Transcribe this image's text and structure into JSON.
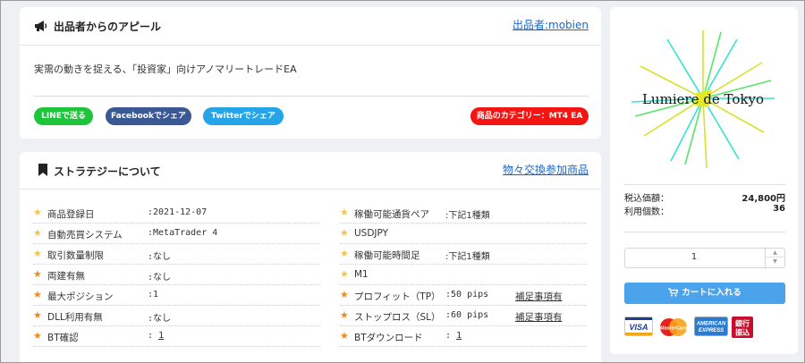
{
  "appeal": {
    "title": "出品者からのアピール",
    "seller_link": "出品者:mobien",
    "text": "実需の動きを捉える、「投資家」向けアノマリートレードEA",
    "share_line": "LINEで送る",
    "share_facebook": "Facebookでシェア",
    "share_twitter": "Twitterでシェア",
    "category": "商品のカテゴリー：MT4 EA"
  },
  "strategy": {
    "title": "ストラテジーについて",
    "exchange_link": "物々交換参加商品",
    "left_rows": [
      {
        "label": "商品登録日",
        "value": ":2021-12-07"
      },
      {
        "label": "自動売買システム",
        "value": ":MetaTrader 4"
      },
      {
        "label": "取引数量制限",
        "value": ":なし"
      },
      {
        "label": "両建有無",
        "value": ":なし"
      },
      {
        "label": "最大ポジション",
        "value": ":1"
      },
      {
        "label": "DLL利用有無",
        "value": ":なし"
      },
      {
        "label": "BT確認",
        "value_prefix": ":",
        "value_link": "1"
      }
    ],
    "right_rows": [
      {
        "label": "稼働可能通貨ペア",
        "value": ":下記1種類"
      },
      {
        "label": "USDJPY"
      },
      {
        "label": "稼働可能時間足",
        "value": ":下記1種類"
      },
      {
        "label": "M1"
      },
      {
        "label": "プロフィット（TP）",
        "value": ":50 pips",
        "note": "補足事項有"
      },
      {
        "label": "ストップロス（SL）",
        "value": ":60 pips",
        "note": "補足事項有"
      },
      {
        "label": "BTダウンロード",
        "value_prefix": ":",
        "value_link": "1"
      }
    ]
  },
  "product": {
    "logo_text": "Lumiere de Tokyo",
    "price_label": "税込価額：",
    "price_value": "24,800円",
    "users_label": "利用個数：",
    "users_value": "36",
    "quantity": "1",
    "cart_button": "カートに入れる",
    "payment_visa": "VISA",
    "payment_master": "MasterCard",
    "payment_amex_1": "AMERICAN",
    "payment_amex_2": "EXPRESS",
    "payment_bank_1": "銀行",
    "payment_bank_2": "振込"
  },
  "colors": {
    "line": "#1ec53a",
    "facebook": "#3a5894",
    "twitter": "#26a4e8",
    "category": "#f21511",
    "cart": "#4ba3ec",
    "link": "#1a66c9"
  },
  "icons": {
    "appeal": "megaphone-icon",
    "strategy": "bookmark-icon",
    "rows": "star-icon",
    "cart": "cart-icon"
  }
}
